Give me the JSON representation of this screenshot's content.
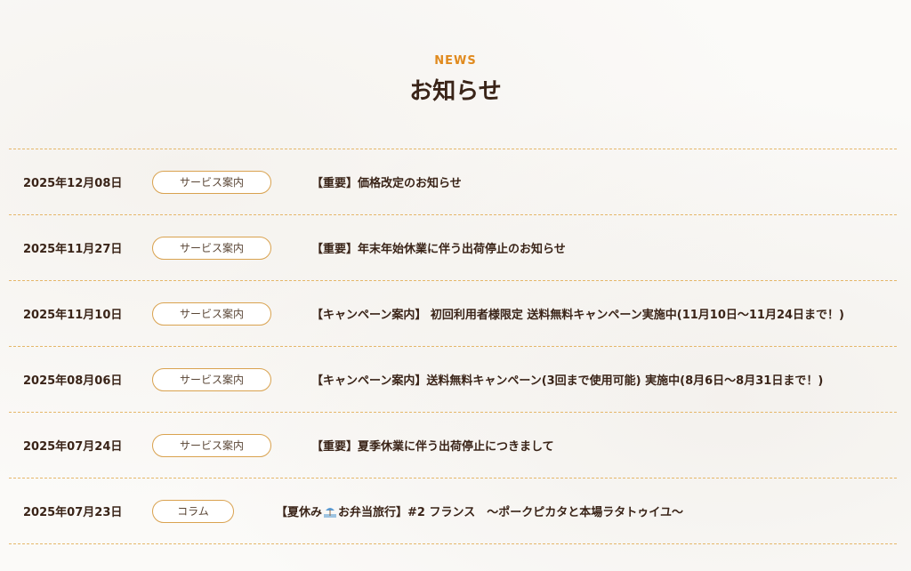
{
  "header": {
    "eyebrow": "NEWS",
    "title": "お知らせ"
  },
  "news": [
    {
      "date": "2025年12月08日",
      "category": "サービス案内",
      "title": "【重要】価格改定のお知らせ"
    },
    {
      "date": "2025年11月27日",
      "category": "サービス案内",
      "title": "【重要】年末年始休業に伴う出荷停止のお知らせ"
    },
    {
      "date": "2025年11月10日",
      "category": "サービス案内",
      "title": "【キャンペーン案内】 初回利用者様限定 送料無料キャンペーン実施中(11月10日〜11月24日まで！)"
    },
    {
      "date": "2025年08月06日",
      "category": "サービス案内",
      "title": "【キャンペーン案内】送料無料キャンペーン(3回まで使用可能) 実施中(8月6日〜8月31日まで！)"
    },
    {
      "date": "2025年07月24日",
      "category": "サービス案内",
      "title": "【重要】夏季休業に伴う出荷停止につきまして"
    },
    {
      "date": "2025年07月23日",
      "category": "コラム",
      "title_prefix": "【夏休み",
      "icon": "beach-umbrella-icon",
      "title_suffix": "お弁当旅行】#2 フランス　〜ポークピカタと本場ラタトゥイユ〜"
    }
  ],
  "colors": {
    "accent": "#e08a1e",
    "border": "#e5b76a",
    "text": "#3a2418"
  }
}
